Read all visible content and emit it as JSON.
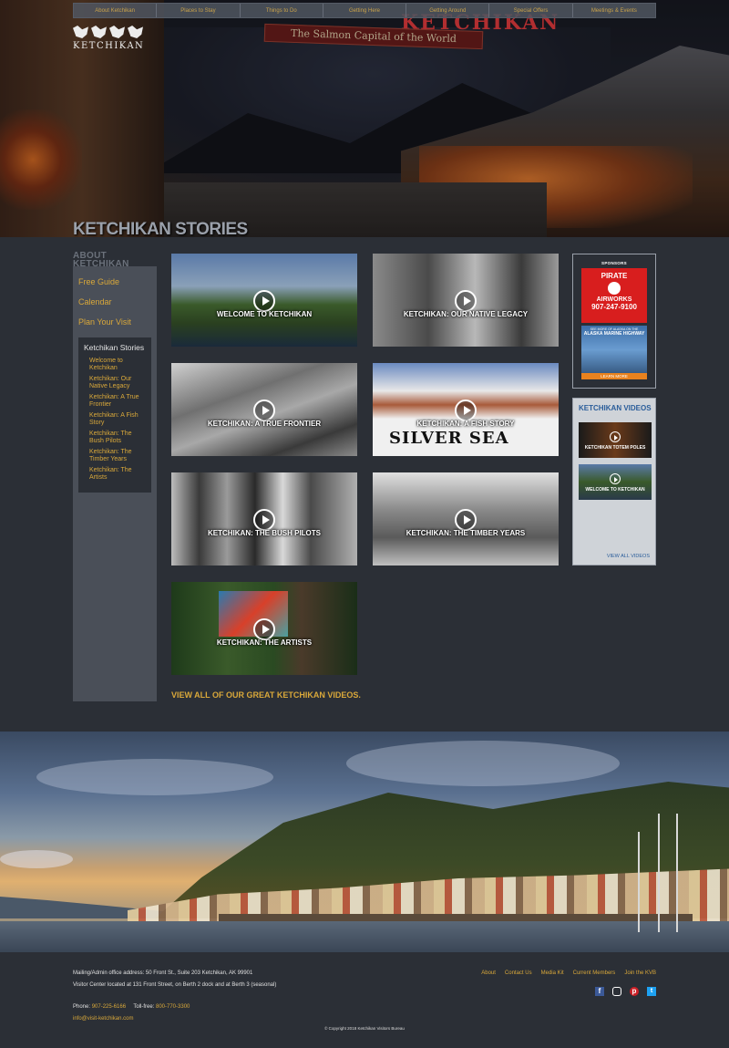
{
  "topnav": [
    "About Ketchikan",
    "Places to Stay",
    "Things to Do",
    "Getting Here",
    "Getting Around",
    "Special Offers",
    "Meetings & Events"
  ],
  "hero": {
    "sign": "The Salmon Capital of the World",
    "neon": "KETCHIKAN",
    "title": "KETCHIKAN STORIES"
  },
  "logo": {
    "word": "KETCHIKAN"
  },
  "sidebar": {
    "tab": "ABOUT KETCHIKAN",
    "links": [
      "Free Guide",
      "Calendar",
      "Plan Your Visit"
    ],
    "box_title": "Ketchikan Stories",
    "box_links": [
      "Welcome to Ketchikan",
      "Ketchikan: Our Native Legacy",
      "Ketchikan: A True Frontier",
      "Ketchikan: A Fish Story",
      "Ketchikan: The Bush Pilots",
      "Ketchikan: The Timber Years",
      "Ketchikan: The Artists"
    ]
  },
  "videos": [
    {
      "caption": "WELCOME TO KETCHIKAN"
    },
    {
      "caption": "KETCHIKAN: OUR NATIVE LEGACY"
    },
    {
      "caption": "KETCHIKAN: A TRUE FRONTIER"
    },
    {
      "caption": "KETCHIKAN: A FISH STORY"
    },
    {
      "caption": "KETCHIKAN: THE BUSH PILOTS"
    },
    {
      "caption": "KETCHIKAN: THE TIMBER YEARS"
    },
    {
      "caption": "KETCHIKAN: THE ARTISTS"
    }
  ],
  "view_all": "VIEW ALL OF OUR GREAT KETCHIKAN VIDEOS.",
  "sponsors": {
    "title": "SPONSORS",
    "ad1": {
      "name": "PIRATE",
      "brand": "AIRWORKS",
      "phone": "907-247-9100"
    },
    "ad2": {
      "tag": "SEE MORE OF ALASKA ON THE",
      "name": "ALASKA MARINE HIGHWAY",
      "button": "LEARN MORE"
    }
  },
  "ketchikan_videos": {
    "title": "KETCHIKAN VIDEOS",
    "items": [
      "KETCHIKAN TOTEM POLES",
      "WELCOME TO KETCHIKAN"
    ],
    "all": "VIEW ALL VIDEOS"
  },
  "footer": {
    "mailing": "Mailing/Admin office address: 50 Front St., Suite 203 Ketchikan, AK 99901",
    "visitor": "Visitor Center located at 131 Front Street, on Berth 2 dock and at Berth 3 (seasonal)",
    "phone_label": "Phone:",
    "phone": "907-225-6166",
    "tollfree_label": "Toll-free:",
    "tollfree": "800-770-3300",
    "email": "info@visit-ketchikan.com",
    "links": [
      "About",
      "Contact Us",
      "Media Kit",
      "Current Members",
      "Join the KVB"
    ],
    "copyright": "© Copyright 2018 Ketchikan Visitors Bureau"
  },
  "colors": {
    "accent": "#d9a83a",
    "bg": "#2b2f36",
    "sidebar": "#4a4f58",
    "link_blue": "#2a5d9a"
  },
  "social_icons": [
    "facebook-icon",
    "instagram-icon",
    "pinterest-icon",
    "twitter-icon"
  ]
}
